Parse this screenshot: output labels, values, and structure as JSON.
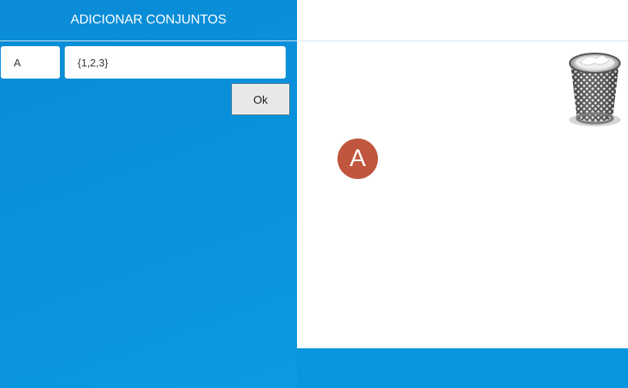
{
  "sidebar": {
    "title": "ADICIONAR CONJUNTOS",
    "name_input_value": "A",
    "elements_input_value": "{1,2,3}",
    "ok_label": "Ok"
  },
  "canvas": {
    "sets": [
      {
        "label": "A"
      }
    ],
    "trash_icon": "trash-can-icon"
  },
  "colors": {
    "sidebar_blue": "#0a92dc",
    "set_circle": "#c0563d",
    "canvas_bg": "#ffffff"
  }
}
